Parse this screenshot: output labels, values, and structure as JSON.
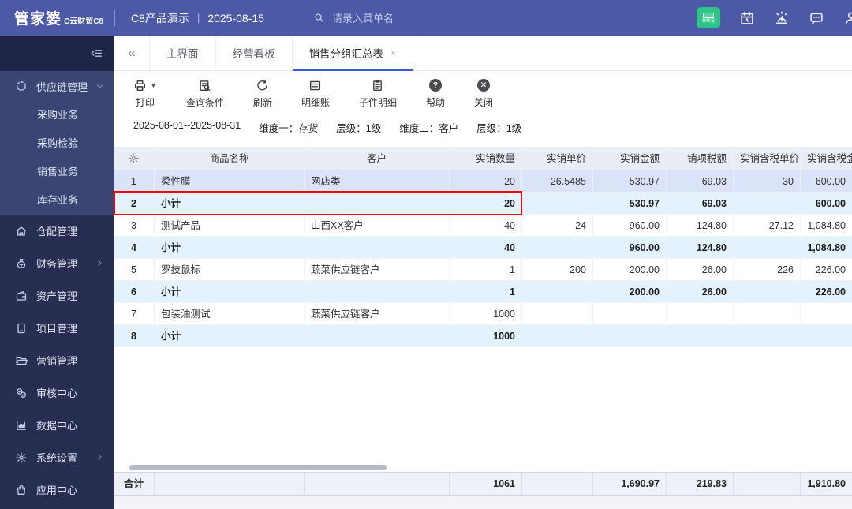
{
  "header": {
    "logo": "管家婆",
    "logo_sub": "C云财贸C8",
    "title": "C8产品演示",
    "date": "2025-08-15",
    "search_placeholder": "请录入菜单名",
    "badge": "物联宝",
    "icons": [
      "calendar-icon",
      "alarm-icon",
      "chat-icon",
      "user-icon"
    ]
  },
  "icons_glyphs": {
    "tabs_collapse": "«",
    "tab_close": "×",
    "print_caret": "▼",
    "bar": "|"
  },
  "tabs": {
    "active_index": 2,
    "items": [
      {
        "key": "main",
        "label": "主界面",
        "closable": false
      },
      {
        "key": "dashboard",
        "label": "经营看板",
        "closable": false
      },
      {
        "key": "sales-group-summary",
        "label": "销售分组汇总表",
        "closable": true
      }
    ]
  },
  "sidebar": {
    "items": [
      {
        "key": "supply-chain",
        "icon": "supply-chain-icon",
        "label": "供应链管理",
        "chevron": "down",
        "expanded": true,
        "children": [
          {
            "key": "purchase",
            "label": "采购业务"
          },
          {
            "key": "purchase-inspection",
            "label": "采购检验"
          },
          {
            "key": "sales",
            "label": "销售业务"
          },
          {
            "key": "inventory",
            "label": "库存业务"
          }
        ]
      },
      {
        "key": "warehouse",
        "icon": "warehouse-icon",
        "label": "仓配管理"
      },
      {
        "key": "finance",
        "icon": "finance-icon",
        "label": "财务管理",
        "chevron": "right"
      },
      {
        "key": "asset",
        "icon": "asset-icon",
        "label": "资产管理"
      },
      {
        "key": "project",
        "icon": "project-icon",
        "label": "项目管理"
      },
      {
        "key": "marketing",
        "icon": "marketing-icon",
        "label": "营销管理"
      },
      {
        "key": "audit",
        "icon": "audit-icon",
        "label": "审核中心"
      },
      {
        "key": "data-center",
        "icon": "data-icon",
        "label": "数据中心"
      },
      {
        "key": "settings",
        "icon": "settings-icon",
        "label": "系统设置",
        "chevron": "right"
      },
      {
        "key": "app-center",
        "icon": "app-icon",
        "label": "应用中心"
      }
    ]
  },
  "toolbar": {
    "buttons": [
      {
        "key": "print",
        "label": "打印",
        "icon": "printer-icon",
        "caret": true
      },
      {
        "key": "query-conditions",
        "label": "查询条件",
        "icon": "query-icon"
      },
      {
        "key": "refresh",
        "label": "刷新",
        "icon": "refresh-icon"
      },
      {
        "key": "detail-ledger",
        "label": "明细账",
        "icon": "ledger-icon"
      },
      {
        "key": "subitem-detail",
        "label": "子件明细",
        "icon": "subitem-icon"
      },
      {
        "key": "help",
        "label": "帮助",
        "glyph": "?"
      },
      {
        "key": "close",
        "label": "关闭",
        "glyph": "✕"
      }
    ]
  },
  "filter": {
    "parts": [
      "2025-08-01--2025-08-31",
      "维度一：存货",
      "层级：1级",
      "维度二：客户",
      "层级：1级"
    ]
  },
  "table": {
    "columns": [
      "商品名称",
      "客户",
      "实销数量",
      "实销单价",
      "实销金额",
      "销项税额",
      "实销含税单价",
      "实销含税金额"
    ],
    "rows": [
      {
        "num": "1",
        "kind": "selected",
        "cells": [
          "柔性膜",
          "网店类",
          "20",
          "26.5485",
          "530.97",
          "69.03",
          "30",
          "600.00"
        ]
      },
      {
        "num": "2",
        "kind": "subtotal",
        "highlight": true,
        "cells": [
          "小计",
          "",
          "20",
          "",
          "530.97",
          "69.03",
          "",
          "600.00"
        ]
      },
      {
        "num": "3",
        "kind": "",
        "cells": [
          "测试产品",
          "山西XX客户",
          "40",
          "24",
          "960.00",
          "124.80",
          "27.12",
          "1,084.80"
        ]
      },
      {
        "num": "4",
        "kind": "subtotal",
        "cells": [
          "小计",
          "",
          "40",
          "",
          "960.00",
          "124.80",
          "",
          "1,084.80"
        ]
      },
      {
        "num": "5",
        "kind": "",
        "cells": [
          "罗技鼠标",
          "蔬菜供应链客户",
          "1",
          "200",
          "200.00",
          "26.00",
          "226",
          "226.00"
        ]
      },
      {
        "num": "6",
        "kind": "subtotal",
        "cells": [
          "小计",
          "",
          "1",
          "",
          "200.00",
          "26.00",
          "",
          "226.00"
        ]
      },
      {
        "num": "7",
        "kind": "",
        "cells": [
          "包装油测试",
          "蔬菜供应链客户",
          "1000",
          "",
          "",
          "",
          "",
          ""
        ]
      },
      {
        "num": "8",
        "kind": "subtotal",
        "cells": [
          "小计",
          "",
          "1000",
          "",
          "",
          "",
          "",
          ""
        ]
      }
    ],
    "total": {
      "label": "合计",
      "cells": [
        "",
        "",
        "1061",
        "",
        "1,690.97",
        "219.83",
        "",
        "1,910.80"
      ]
    }
  },
  "colors": {
    "topbar": "#4c59a7",
    "sidebar": "#272e52",
    "sidebar_expanded": "#3a4574",
    "tab_accent": "#3a5bd9",
    "selected_row": "#dbe3f8",
    "subtotal_row": "#e3f2fc",
    "highlight_red": "#ea0b0b",
    "badge_green": "#2fc487"
  }
}
